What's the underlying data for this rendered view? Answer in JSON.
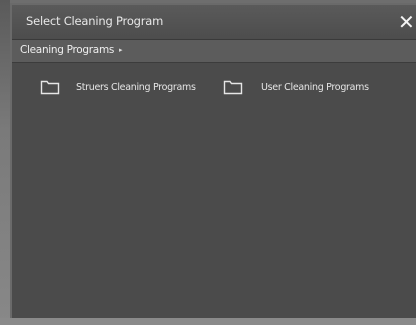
{
  "dialog": {
    "title": "Select Cleaning Program",
    "close_glyph": "✕"
  },
  "breadcrumb": {
    "label": "Cleaning Programs",
    "arrow": "▸"
  },
  "folders": [
    {
      "label": "Struers Cleaning Programs",
      "icon": "folder-icon"
    },
    {
      "label": "User Cleaning Programs",
      "icon": "folder-icon"
    }
  ],
  "colors": {
    "dialog_bg": "#4a4a4a",
    "titlebar": "#555555",
    "text": "#e8e8e8"
  }
}
